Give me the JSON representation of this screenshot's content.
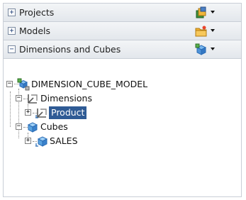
{
  "sections": [
    {
      "label": "Projects",
      "toggle": "+",
      "icon": "projects-icon"
    },
    {
      "label": "Models",
      "toggle": "+",
      "icon": "models-icon"
    },
    {
      "label": "Dimensions and Cubes",
      "toggle": "−",
      "icon": "dimensions-cubes-icon"
    }
  ],
  "tree": {
    "root": {
      "label": "DIMENSION_CUBE_MODEL",
      "icon": "model-icon",
      "expander": "−"
    },
    "dimensions": {
      "label": "Dimensions",
      "icon": "dimensions-folder-icon",
      "expander": "−"
    },
    "product": {
      "label": "Product",
      "icon": "dimension-icon",
      "expander": "+",
      "selected": true
    },
    "cubes": {
      "label": "Cubes",
      "icon": "cubes-folder-icon",
      "expander": "−"
    },
    "sales": {
      "label": "SALES",
      "icon": "cube-icon",
      "expander": "+"
    }
  },
  "colors": {
    "selection": "#2f5b95",
    "header_bg": "#e3e7ec"
  }
}
